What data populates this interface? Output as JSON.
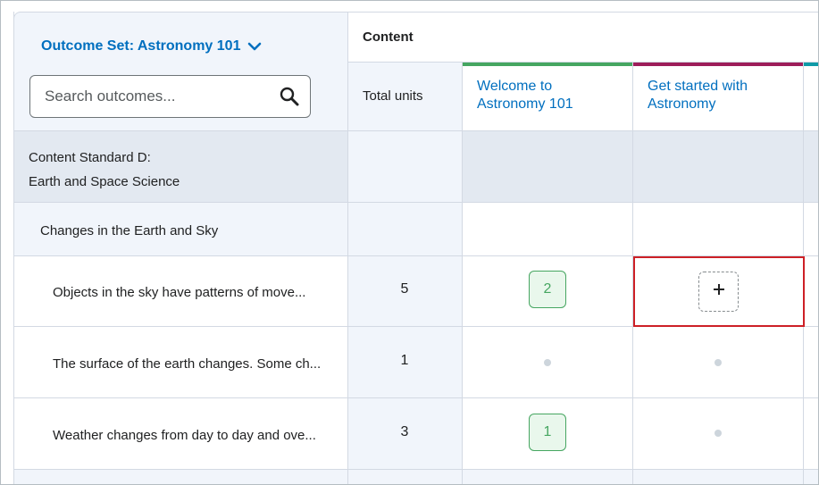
{
  "outcomes_panel": {
    "outcome_set_label": "Outcome Set: Astronomy 101",
    "search_placeholder": "Search outcomes..."
  },
  "content": {
    "header_title": "Content",
    "total_units_label": "Total units",
    "columns": [
      {
        "title_line1": "Welcome to",
        "title_line2": "Astronomy 101",
        "accent": "#46a661"
      },
      {
        "title_line1": "Get started with",
        "title_line2": "Astronomy",
        "accent": "#9d1d5a"
      },
      {
        "accent": "#0e9aa7"
      }
    ]
  },
  "rows": {
    "standard": {
      "line1": "Content Standard D:",
      "line2": "Earth and Space Science"
    },
    "group": {
      "label": "Changes in the Earth and Sky"
    },
    "outcomes": [
      {
        "label": "Objects in the sky have patterns of move...",
        "total": "5",
        "col1": "2",
        "col2_add": "+"
      },
      {
        "label": "The surface of the earth changes. Some ch...",
        "total": "1"
      },
      {
        "label": "Weather changes from day to day and ove...",
        "total": "3",
        "col1": "1"
      }
    ]
  },
  "colors": {
    "link": "#006fbf",
    "selection_border": "#cd2026",
    "badge_green": "#46a661",
    "header_bg": "#f1f5fb",
    "standard_row_bg": "#e3e9f1"
  }
}
